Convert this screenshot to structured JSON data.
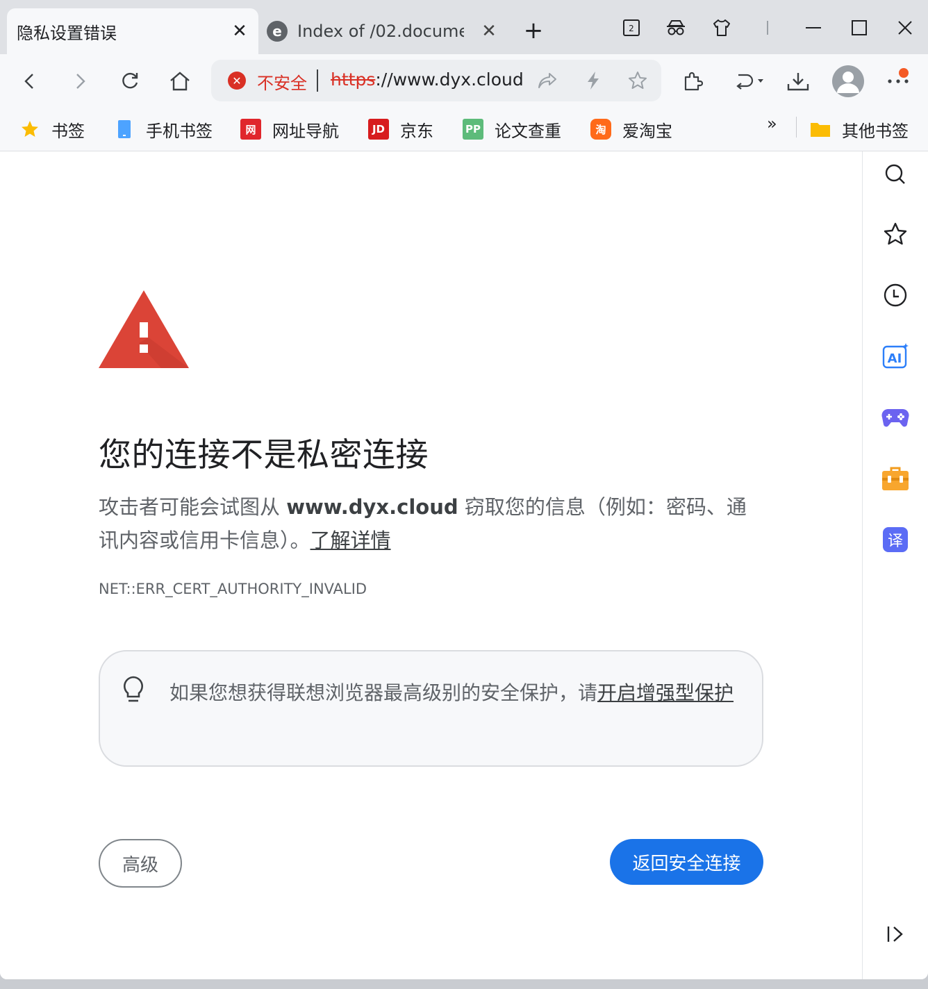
{
  "tabs": [
    {
      "title": "隐私设置错误",
      "active": true
    },
    {
      "title": "Index of /02.docume",
      "active": false
    }
  ],
  "tabstrip": {
    "tab_count_badge": "2"
  },
  "omnibox": {
    "security_label": "不安全",
    "url_scheme": "https",
    "url_rest": "://www.dyx.cloud"
  },
  "bookmarks": [
    {
      "label": "书签",
      "icon": "star-icon"
    },
    {
      "label": "手机书签",
      "icon": "phone-icon"
    },
    {
      "label": "网址导航",
      "icon": "nav-icon"
    },
    {
      "label": "京东",
      "icon": "jd-icon"
    },
    {
      "label": "论文查重",
      "icon": "pp-icon"
    },
    {
      "label": "爱淘宝",
      "icon": "taobao-icon"
    }
  ],
  "bookmarks_more": "»",
  "other_bookmarks": "其他书签",
  "page": {
    "headline": "您的连接不是私密连接",
    "desc_prefix": "攻击者可能会试图从 ",
    "desc_domain": "www.dyx.cloud",
    "desc_suffix": " 窃取您的信息（例如：密码、通讯内容或信用卡信息）。",
    "learn_more": "了解详情",
    "error_code": "NET::ERR_CERT_AUTHORITY_INVALID",
    "tip_text": "如果您想获得联想浏览器最高级别的安全保护，请",
    "tip_link": "开启增强型保护",
    "advanced_button": "高级",
    "back_button": "返回安全连接"
  },
  "colors": {
    "accent": "#1a73e8",
    "danger": "#d93025",
    "warning_triangle": "#db4437"
  }
}
